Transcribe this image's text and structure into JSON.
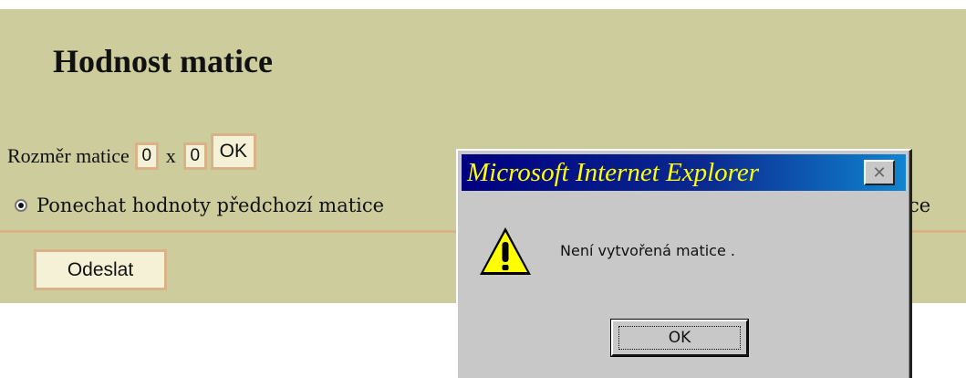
{
  "page": {
    "title": "Hodnost matice",
    "size_label": "Rozměr matice",
    "rows_value": "0",
    "times_symbol": "x",
    "cols_value": "0",
    "ok_label": "OK",
    "radio_option_1": "Ponechat hodnoty předchozí matice",
    "radio_option_2_partial": "ce",
    "send_label": "Odeslat"
  },
  "dialog": {
    "title": "Microsoft Internet Explorer",
    "close_symbol": "✕",
    "message": "Není vytvořená matice .",
    "ok_label": "OK",
    "icon": "warning-icon"
  },
  "colors": {
    "page_background": "#cdcc9d",
    "accent_border": "#d9b287",
    "dialog_title_start": "#000080",
    "dialog_title_end": "#1084d0",
    "dialog_title_text": "#ffff00"
  }
}
